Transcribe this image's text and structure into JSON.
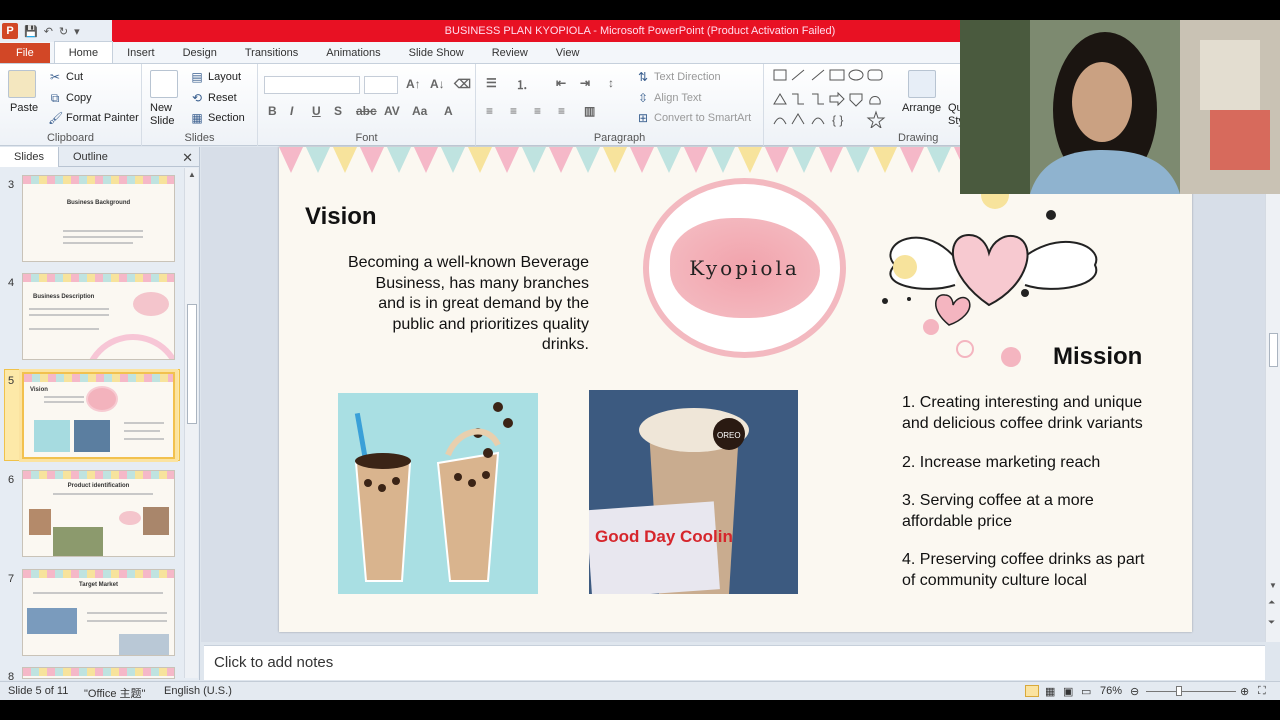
{
  "window": {
    "title": "BUSINESS PLAN KYOPIOLA  -  Microsoft PowerPoint (Product Activation Failed)"
  },
  "menu": {
    "tabs": [
      "File",
      "Home",
      "Insert",
      "Design",
      "Transitions",
      "Animations",
      "Slide Show",
      "Review",
      "View"
    ],
    "active": "Home"
  },
  "ribbon": {
    "clipboard": {
      "label": "Clipboard",
      "paste": "Paste",
      "cut": "Cut",
      "copy": "Copy",
      "format_painter": "Format Painter"
    },
    "slides": {
      "label": "Slides",
      "new_slide": "New Slide",
      "layout": "Layout",
      "reset": "Reset",
      "section": "Section"
    },
    "font": {
      "label": "Font"
    },
    "paragraph": {
      "label": "Paragraph",
      "text_direction": "Text Direction",
      "align_text": "Align Text",
      "convert_smartart": "Convert to SmartArt"
    },
    "drawing": {
      "label": "Drawing",
      "arrange": "Arrange",
      "quick_styles": "Qui Sty"
    }
  },
  "left_pane": {
    "tab_slides": "Slides",
    "tab_outline": "Outline",
    "close": "✕",
    "thumbnails": [
      {
        "num": "3",
        "title": "Business Background"
      },
      {
        "num": "4",
        "title": "Business Description"
      },
      {
        "num": "5",
        "title": "Vision"
      },
      {
        "num": "6",
        "title": "Product identification"
      },
      {
        "num": "7",
        "title": "Target Market"
      },
      {
        "num": "8",
        "title": ""
      }
    ]
  },
  "slide": {
    "vision_title": "Vision",
    "vision_text_lines": [
      "Becoming a well-known Beverage",
      "Business, has many branches",
      "and is in great demand by the",
      "public and prioritizes quality",
      "drinks."
    ],
    "logo_text": "Kyopiola",
    "mission_title": "Mission",
    "mission_items": [
      [
        "1. Creating interesting and unique",
        "and delicious coffee drink variants"
      ],
      [
        "2. Increase marketing reach"
      ],
      [
        "3. Serving coffee at a more",
        "affordable price"
      ],
      [
        "4. Preserving coffee drinks as part",
        "of community  culture local"
      ]
    ],
    "sachet_text": "Good Day Coolin",
    "oreo_text": "OREO"
  },
  "notes": {
    "placeholder": "Click to add notes"
  },
  "status": {
    "slide_info": "Slide 5 of 11",
    "theme": "\"Office 主题\"",
    "language": "English (U.S.)",
    "zoom": "76%"
  }
}
